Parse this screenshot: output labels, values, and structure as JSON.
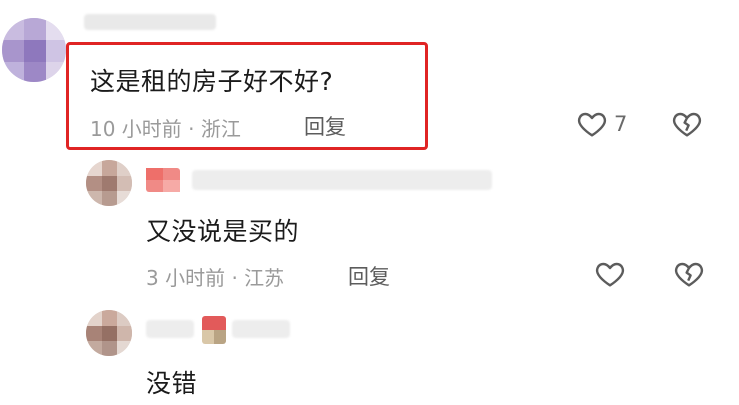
{
  "comments": [
    {
      "text": "这是租的房子好不好?",
      "meta": "10 小时前 · 浙江",
      "reply_label": "回复",
      "like_count": "7",
      "highlighted": true
    },
    {
      "text": "又没说是买的",
      "meta": "3 小时前 · 江苏",
      "reply_label": "回复",
      "highlighted": false
    },
    {
      "text": "没错",
      "highlighted": false
    }
  ],
  "colors": {
    "highlight_border": "#e02424",
    "meta_text": "#9a9a9a",
    "body_text": "#1b1b1b"
  },
  "icons": [
    "heart-outline-icon",
    "broken-heart-icon"
  ]
}
